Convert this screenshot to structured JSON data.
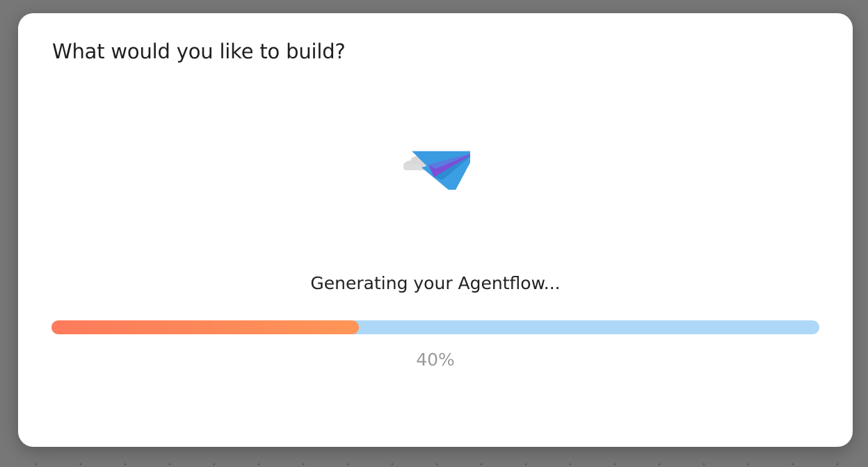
{
  "dialog": {
    "title": "What would you like to build?",
    "illustration_icon": "paper-plane-icon",
    "status_text": "Generating your Agentflow...",
    "progress": {
      "value": 0.4,
      "label": "40%"
    }
  },
  "colors": {
    "progress_fill_start": "#ff7a5c",
    "progress_fill_end": "#ff9657",
    "progress_track": "#aed8f8",
    "plane_blue": "#3a9be0",
    "plane_purple": "#7b4fd6"
  }
}
